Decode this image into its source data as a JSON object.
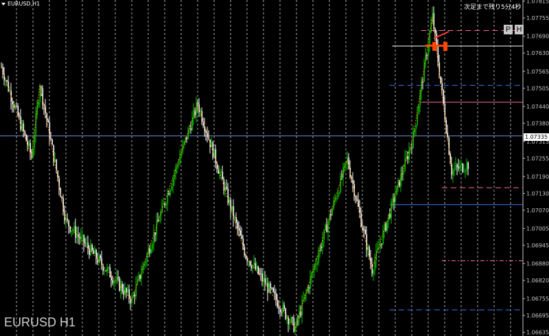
{
  "window": {
    "title": "EURUSD,H1",
    "watermark": "EURUSD H1",
    "countdown": "次足まで残り5分4秒"
  },
  "buttons": {
    "p_label": "P",
    "h_label": "H"
  },
  "current_price": "1.07335",
  "colors": {
    "background": "#000000",
    "bull_candle": "#00c000",
    "bear_candle": "#ffffff",
    "zigzag": "#ff8c00",
    "current_price_line": "#6e8fd8",
    "grid": "#c8c8c8"
  },
  "chart_data": {
    "type": "candlestick",
    "symbol": "EURUSD",
    "timeframe": "H1",
    "ylim": [
      1.06622,
      1.07819
    ],
    "y_ticks": [
      "1.07815",
      "1.07755",
      "1.07690",
      "1.07630",
      "1.07565",
      "1.07505",
      "1.07440",
      "1.07380",
      "1.07315",
      "1.07255",
      "1.07190",
      "1.07130",
      "1.07070",
      "1.07005",
      "1.06945",
      "1.06880",
      "1.06820",
      "1.06755",
      "1.06695",
      "1.06635"
    ],
    "current_price": 1.07335,
    "zigzag_points": [
      {
        "bar": 0,
        "price": 1.0758
      },
      {
        "bar": 22,
        "price": 1.0726
      },
      {
        "bar": 28,
        "price": 1.0752
      },
      {
        "bar": 47,
        "price": 1.0703
      },
      {
        "bar": 95,
        "price": 1.0675
      },
      {
        "bar": 143,
        "price": 1.0745
      },
      {
        "bar": 178,
        "price": 1.0691
      },
      {
        "bar": 214,
        "price": 1.0665
      },
      {
        "bar": 252,
        "price": 1.0725
      },
      {
        "bar": 270,
        "price": 1.0686
      },
      {
        "bar": 300,
        "price": 1.0733
      },
      {
        "bar": 314,
        "price": 1.0776
      },
      {
        "bar": 328,
        "price": 1.0721
      }
    ],
    "levels": [
      {
        "price": 1.0771,
        "color": "#ff6e9a",
        "style": "dashed",
        "x_start": 0.805
      },
      {
        "price": 1.07655,
        "color": "#ffffff",
        "style": "solid",
        "x_start": 0.75
      },
      {
        "price": 1.07515,
        "color": "#3a78ff",
        "style": "dashed",
        "x_start": 0.745
      },
      {
        "price": 1.07455,
        "color": "#ff6e9a",
        "style": "solid",
        "x_start": 0.805
      },
      {
        "price": 1.07335,
        "color": "#6e8fd8",
        "style": "solid",
        "x_start": 0.0
      },
      {
        "price": 1.0715,
        "color": "#ff6e9a",
        "style": "dashed",
        "x_start": 0.845
      },
      {
        "price": 1.0709,
        "color": "#3a78ff",
        "style": "solid",
        "x_start": 0.745
      },
      {
        "price": 1.0689,
        "color": "#ff6e9a",
        "style": "dashdot",
        "x_start": 0.845
      },
      {
        "price": 1.06715,
        "color": "#3a78ff",
        "style": "dashed",
        "x_start": 0.745
      }
    ],
    "grid": true,
    "last_bar": 340,
    "legend": "none"
  }
}
